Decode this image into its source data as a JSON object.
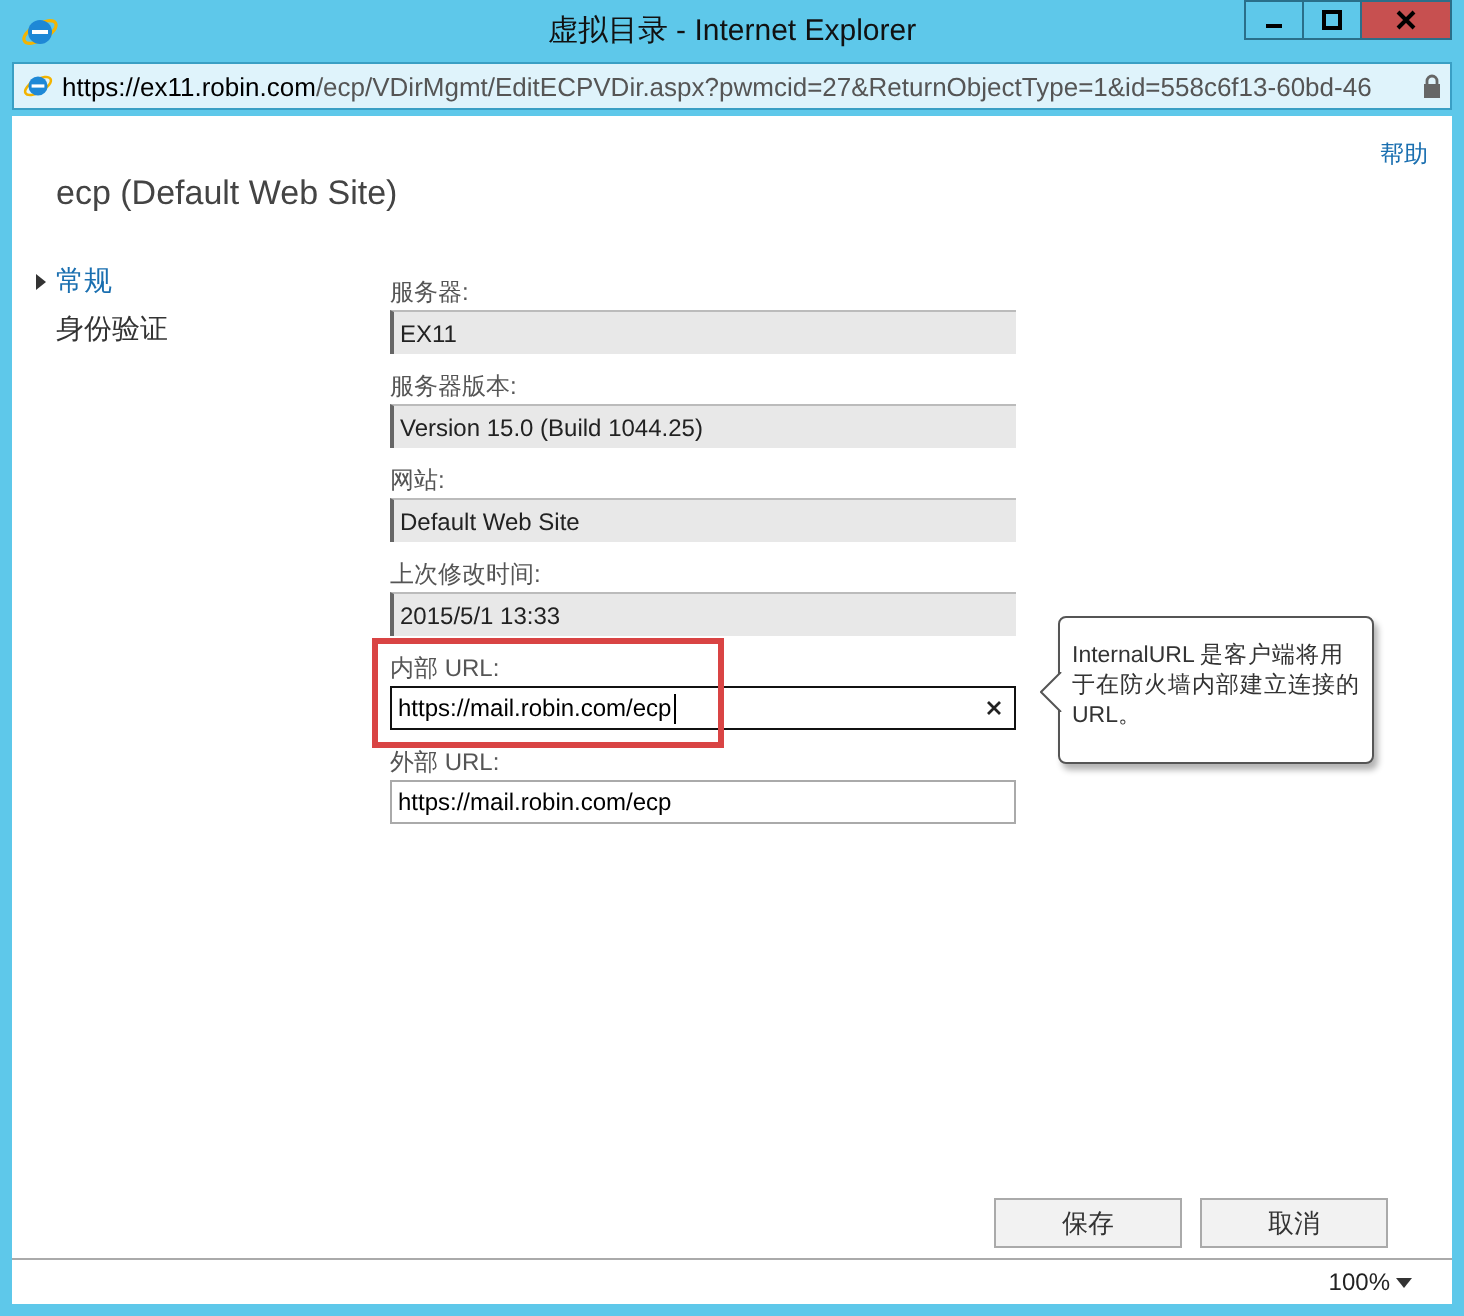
{
  "window": {
    "title": "虚拟目录 - Internet Explorer"
  },
  "address_bar": {
    "host": "https://ex11.robin.com",
    "path": "/ecp/VDirMgmt/EditECPVDir.aspx?pwmcid=27&ReturnObjectType=1&id=558c6f13-60bd-46"
  },
  "help_link": "帮助",
  "page_title": "ecp (Default Web Site)",
  "nav": [
    {
      "label": "常规",
      "selected": true
    },
    {
      "label": "身份验证",
      "selected": false
    }
  ],
  "fields": [
    {
      "label": "服务器:",
      "value": "EX11",
      "kind": "readonly",
      "highlighted": false,
      "focused": false
    },
    {
      "label": "服务器版本:",
      "value": "Version 15.0 (Build 1044.25)",
      "kind": "readonly",
      "highlighted": false,
      "focused": false
    },
    {
      "label": "网站:",
      "value": "Default Web Site",
      "kind": "readonly",
      "highlighted": false,
      "focused": false
    },
    {
      "label": "上次修改时间:",
      "value": "2015/5/1 13:33",
      "kind": "readonly",
      "highlighted": false,
      "focused": false
    },
    {
      "label": "内部 URL:",
      "value": "https://mail.robin.com/ecp",
      "kind": "text",
      "highlighted": true,
      "focused": true
    },
    {
      "label": "外部 URL:",
      "value": "https://mail.robin.com/ecp",
      "kind": "text",
      "highlighted": false,
      "focused": false
    }
  ],
  "tooltip": "InternalURL 是客户端将用于在防火墙内部建立连接的URL。",
  "buttons": [
    "保存",
    "取消"
  ],
  "status_bar": {
    "zoom": "100%"
  }
}
